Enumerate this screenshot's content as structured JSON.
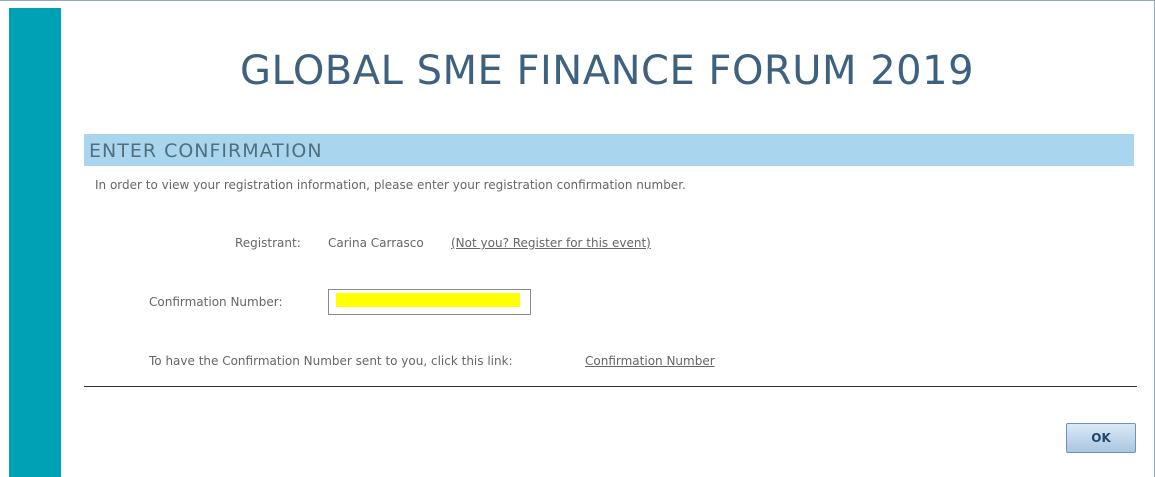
{
  "event": {
    "title": "GLOBAL SME FINANCE FORUM 2019"
  },
  "section": {
    "header": "ENTER CONFIRMATION",
    "instructions": "In order to view your registration information, please enter your registration confirmation number."
  },
  "registrant": {
    "label": "Registrant:",
    "name": "Carina Carrasco",
    "not_you_link": "(Not you?  Register for this event)"
  },
  "confirmation": {
    "label": "Confirmation Number:",
    "value": "",
    "highlight_color": "#ffff00"
  },
  "send_confirmation": {
    "text": "To have the Confirmation Number sent to you, click this link:",
    "link": "Confirmation Number"
  },
  "actions": {
    "ok_label": "OK"
  },
  "colors": {
    "left_bar": "#00a0b5",
    "section_header_bg": "#a9d6ee",
    "title_text": "#3e6180"
  }
}
